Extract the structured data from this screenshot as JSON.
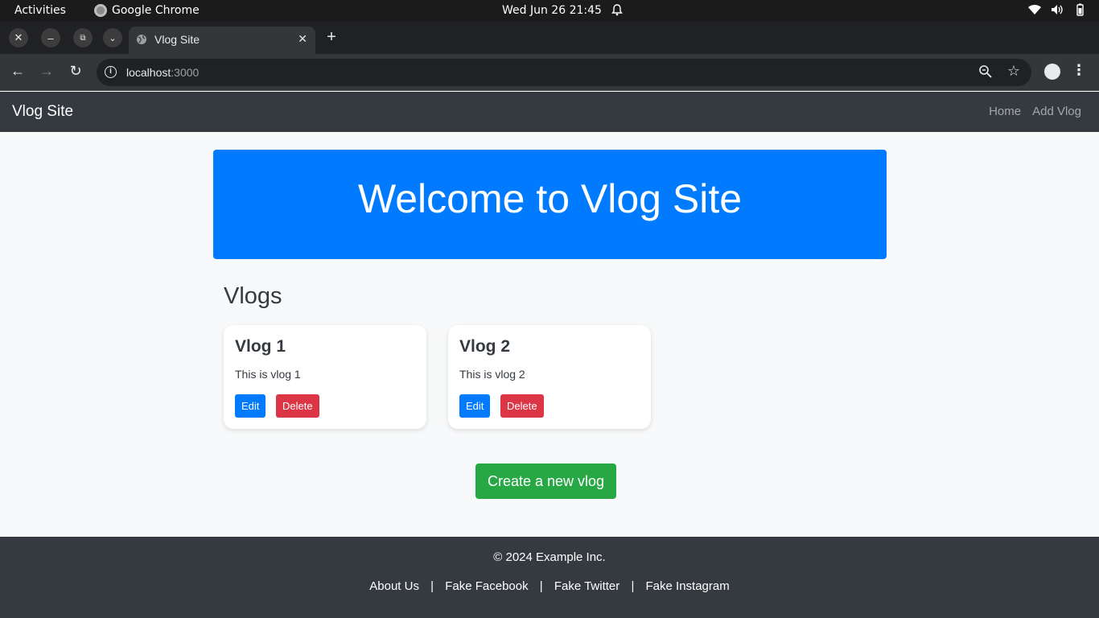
{
  "os": {
    "activities": "Activities",
    "app_name": "Google Chrome",
    "clock": "Wed Jun 26  21:45"
  },
  "browser": {
    "tab_title": "Vlog Site",
    "url_host": "localhost",
    "url_port": ":3000"
  },
  "navbar": {
    "brand": "Vlog Site",
    "links": [
      "Home",
      "Add Vlog"
    ]
  },
  "hero": {
    "title": "Welcome to Vlog Site"
  },
  "vlogs_section": {
    "title": "Vlogs",
    "cards": [
      {
        "title": "Vlog 1",
        "body": "This is vlog 1",
        "edit": "Edit",
        "delete": "Delete"
      },
      {
        "title": "Vlog 2",
        "body": "This is vlog 2",
        "edit": "Edit",
        "delete": "Delete"
      }
    ]
  },
  "create_button": "Create a new vlog",
  "footer": {
    "copyright": "© 2024 Example Inc.",
    "links": [
      "About Us",
      "Fake Facebook",
      "Fake Twitter",
      "Fake Instagram"
    ],
    "separator": "|"
  },
  "colors": {
    "primary": "#007bff",
    "danger": "#dc3545",
    "success": "#28a745",
    "dark": "#343a40"
  }
}
